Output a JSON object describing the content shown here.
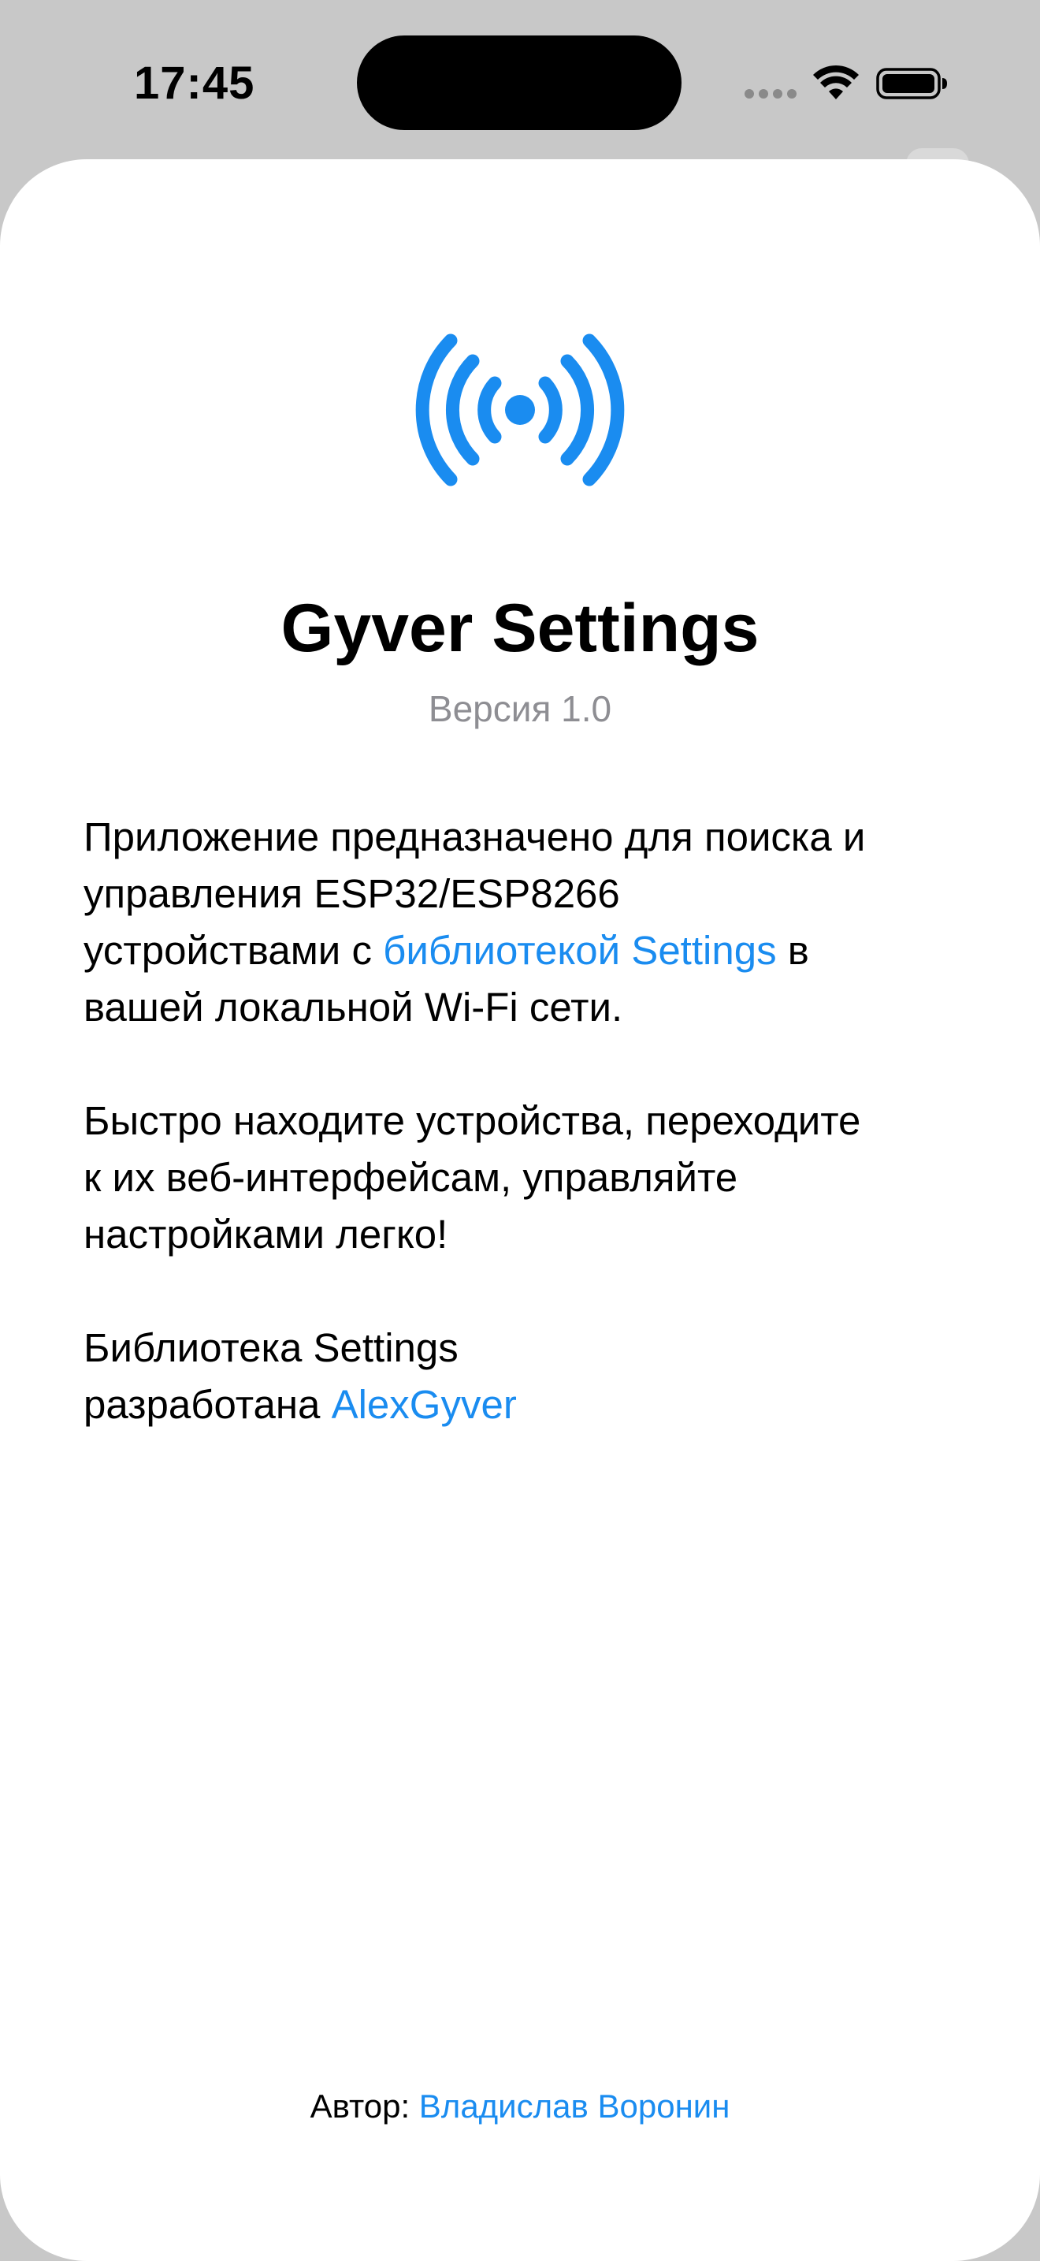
{
  "status_bar": {
    "time": "17:45"
  },
  "about": {
    "icon": "antenna-broadcast-icon",
    "title": "Gyver Settings",
    "version": "Версия 1.0",
    "paragraph1": {
      "lines": [
        "Приложение предназначено для поиска и",
        "управления ESP32/ESP8266"
      ],
      "line3_before": "устройствами с ",
      "link_text": "библиотекой Settings",
      "line3_after": " в",
      "line4": "вашей локальной Wi-Fi сети."
    },
    "paragraph2": {
      "lines": [
        "Быстро находите устройства, переходите",
        "к их веб-интерфейсам, управляйте",
        "настройками легко!"
      ]
    },
    "paragraph3": {
      "line1": "Библиотека Settings",
      "line2_before": "разработана ",
      "link_text": "AlexGyver"
    },
    "footer": {
      "label": "Автор: ",
      "author_link": "Владислав Воронин"
    }
  },
  "colors": {
    "accent": "#1a8cf0",
    "secondary_text": "#8e8e93",
    "background_dim": "#c8c8c8"
  }
}
